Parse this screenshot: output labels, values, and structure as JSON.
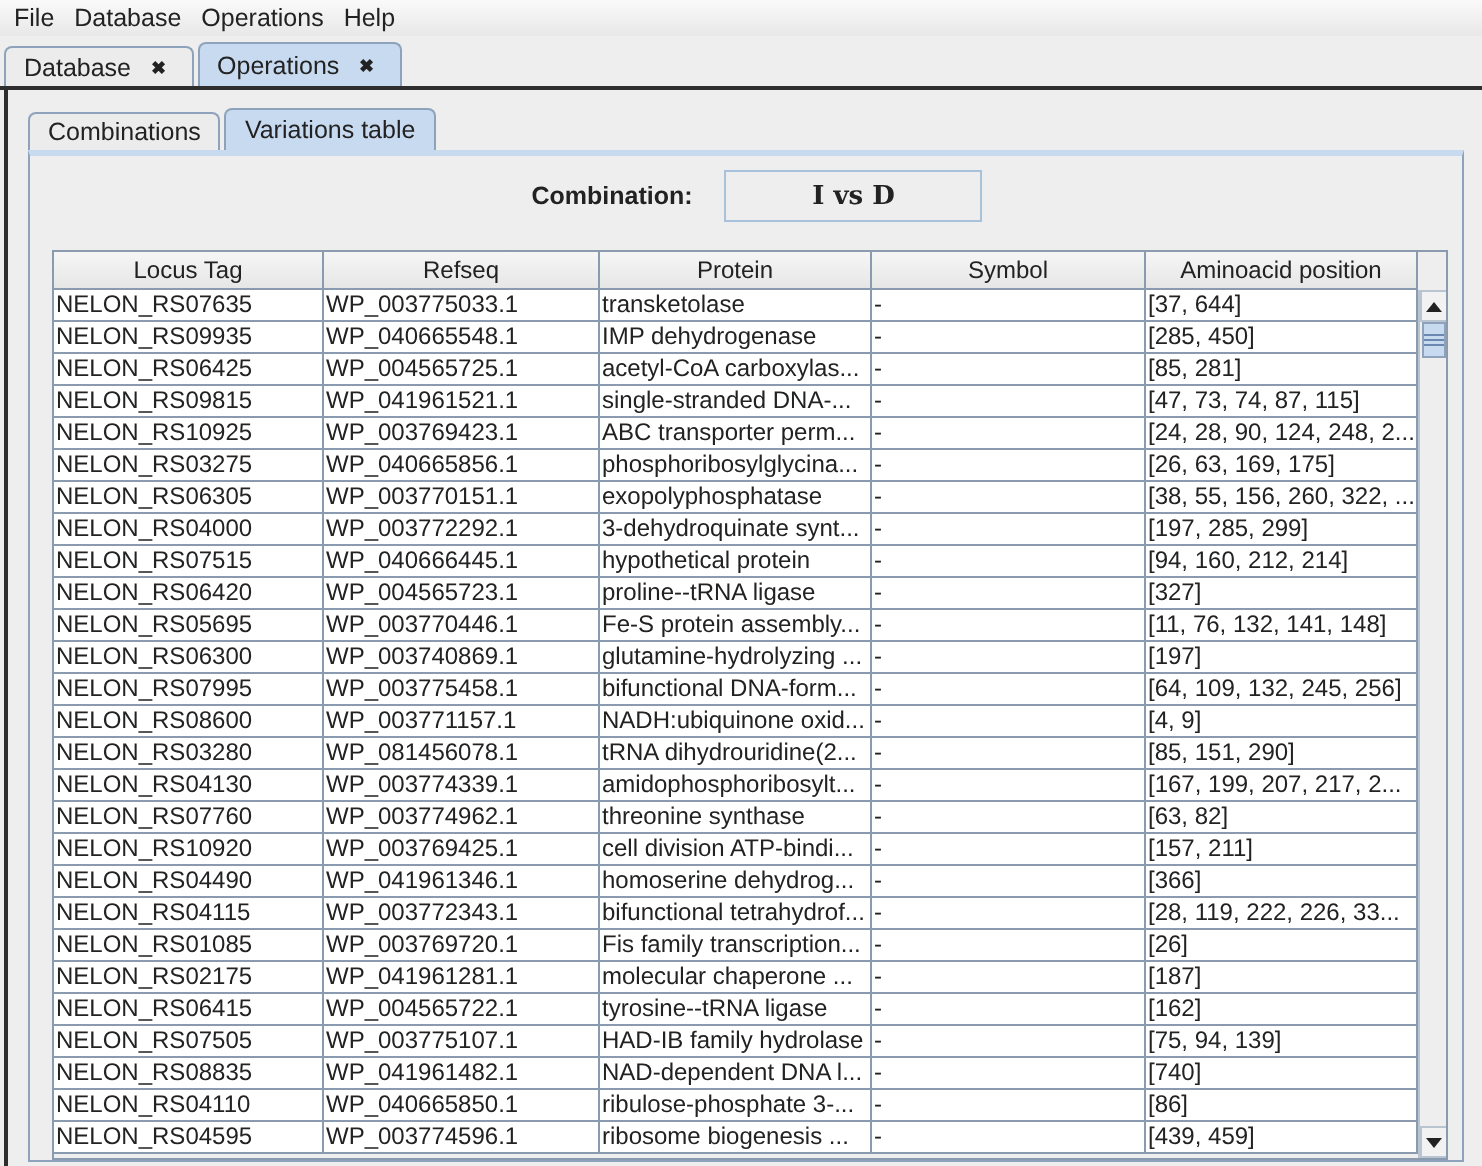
{
  "menu": [
    "File",
    "Database",
    "Operations",
    "Help"
  ],
  "tabs": [
    {
      "label": "Database",
      "selected": false,
      "close": "✖"
    },
    {
      "label": "Operations",
      "selected": true,
      "close": "✖"
    }
  ],
  "subtabs": [
    {
      "label": "Combinations",
      "selected": false
    },
    {
      "label": "Variations table",
      "selected": true
    }
  ],
  "combination": {
    "label": "Combination:",
    "value": "I vs D"
  },
  "table": {
    "columns": [
      "Locus Tag",
      "Refseq",
      "Protein",
      "Symbol",
      "Aminoacid position"
    ],
    "rows": [
      [
        "NELON_RS07635",
        "WP_003775033.1",
        "transketolase",
        "-",
        "[37, 644]"
      ],
      [
        "NELON_RS09935",
        "WP_040665548.1",
        "IMP dehydrogenase",
        "-",
        "[285, 450]"
      ],
      [
        "NELON_RS06425",
        "WP_004565725.1",
        "acetyl-CoA carboxylas...",
        "-",
        "[85, 281]"
      ],
      [
        "NELON_RS09815",
        "WP_041961521.1",
        "single-stranded DNA-...",
        "-",
        "[47, 73, 74, 87, 115]"
      ],
      [
        "NELON_RS10925",
        "WP_003769423.1",
        "ABC transporter perm...",
        "-",
        "[24, 28, 90, 124, 248, 2..."
      ],
      [
        "NELON_RS03275",
        "WP_040665856.1",
        "phosphoribosylglycina...",
        "-",
        "[26, 63, 169, 175]"
      ],
      [
        "NELON_RS06305",
        "WP_003770151.1",
        "exopolyphosphatase",
        "-",
        "[38, 55, 156, 260, 322, ..."
      ],
      [
        "NELON_RS04000",
        "WP_003772292.1",
        "3-dehydroquinate synt...",
        "-",
        "[197, 285, 299]"
      ],
      [
        "NELON_RS07515",
        "WP_040666445.1",
        "hypothetical protein",
        "-",
        "[94, 160, 212, 214]"
      ],
      [
        "NELON_RS06420",
        "WP_004565723.1",
        "proline--tRNA ligase",
        "-",
        "[327]"
      ],
      [
        "NELON_RS05695",
        "WP_003770446.1",
        "Fe-S protein assembly...",
        "-",
        "[11, 76, 132, 141, 148]"
      ],
      [
        "NELON_RS06300",
        "WP_003740869.1",
        "glutamine-hydrolyzing ...",
        "-",
        "[197]"
      ],
      [
        "NELON_RS07995",
        "WP_003775458.1",
        "bifunctional DNA-form...",
        "-",
        "[64, 109, 132, 245, 256]"
      ],
      [
        "NELON_RS08600",
        "WP_003771157.1",
        "NADH:ubiquinone oxid...",
        "-",
        "[4, 9]"
      ],
      [
        "NELON_RS03280",
        "WP_081456078.1",
        "tRNA dihydrouridine(2...",
        "-",
        "[85, 151, 290]"
      ],
      [
        "NELON_RS04130",
        "WP_003774339.1",
        "amidophosphoribosylt...",
        "-",
        "[167, 199, 207, 217, 2..."
      ],
      [
        "NELON_RS07760",
        "WP_003774962.1",
        "threonine synthase",
        "-",
        "[63, 82]"
      ],
      [
        "NELON_RS10920",
        "WP_003769425.1",
        "cell division ATP-bindi...",
        "-",
        "[157, 211]"
      ],
      [
        "NELON_RS04490",
        "WP_041961346.1",
        "homoserine dehydrog...",
        "-",
        "[366]"
      ],
      [
        "NELON_RS04115",
        "WP_003772343.1",
        "bifunctional tetrahydrof...",
        "-",
        "[28, 119, 222, 226, 33..."
      ],
      [
        "NELON_RS01085",
        "WP_003769720.1",
        "Fis family transcription...",
        "-",
        "[26]"
      ],
      [
        "NELON_RS02175",
        "WP_041961281.1",
        "molecular chaperone ...",
        "-",
        "[187]"
      ],
      [
        "NELON_RS06415",
        "WP_004565722.1",
        "tyrosine--tRNA ligase",
        "-",
        "[162]"
      ],
      [
        "NELON_RS07505",
        "WP_003775107.1",
        "HAD-IB family hydrolase",
        "-",
        "[75, 94, 139]"
      ],
      [
        "NELON_RS08835",
        "WP_041961482.1",
        "NAD-dependent DNA l...",
        "-",
        "[740]"
      ],
      [
        "NELON_RS04110",
        "WP_040665850.1",
        "ribulose-phosphate 3-...",
        "-",
        "[86]"
      ],
      [
        "NELON_RS04595",
        "WP_003774596.1",
        "ribosome biogenesis ...",
        "-",
        "[439, 459]"
      ]
    ]
  }
}
